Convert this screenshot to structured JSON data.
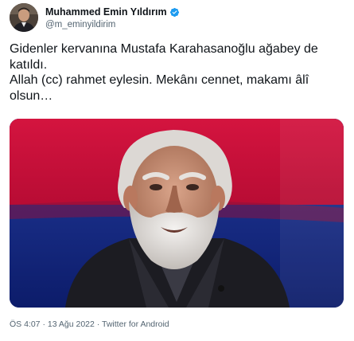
{
  "author": {
    "display_name": "Muhammed Emin Yıldırım",
    "handle": "@m_eminyildirim",
    "verified": true,
    "verified_color": "#1d9bf0"
  },
  "tweet": {
    "lines": [
      "Gidenler kervanına Mustafa Karahasanoğlu ağabey de katıldı.",
      "Allah (cc) rahmet eylesin. Mekânı cennet, makamı âlî olsun…"
    ]
  },
  "media": {
    "description_icon": "photo-of-elderly-man-with-white-beard",
    "background_colors": [
      "#c8103a",
      "#1b2f8f"
    ]
  },
  "meta": {
    "time": "ÖS 4:07",
    "separator": "·",
    "date": "13 Ağu 2022",
    "source": "Twitter for Android"
  }
}
